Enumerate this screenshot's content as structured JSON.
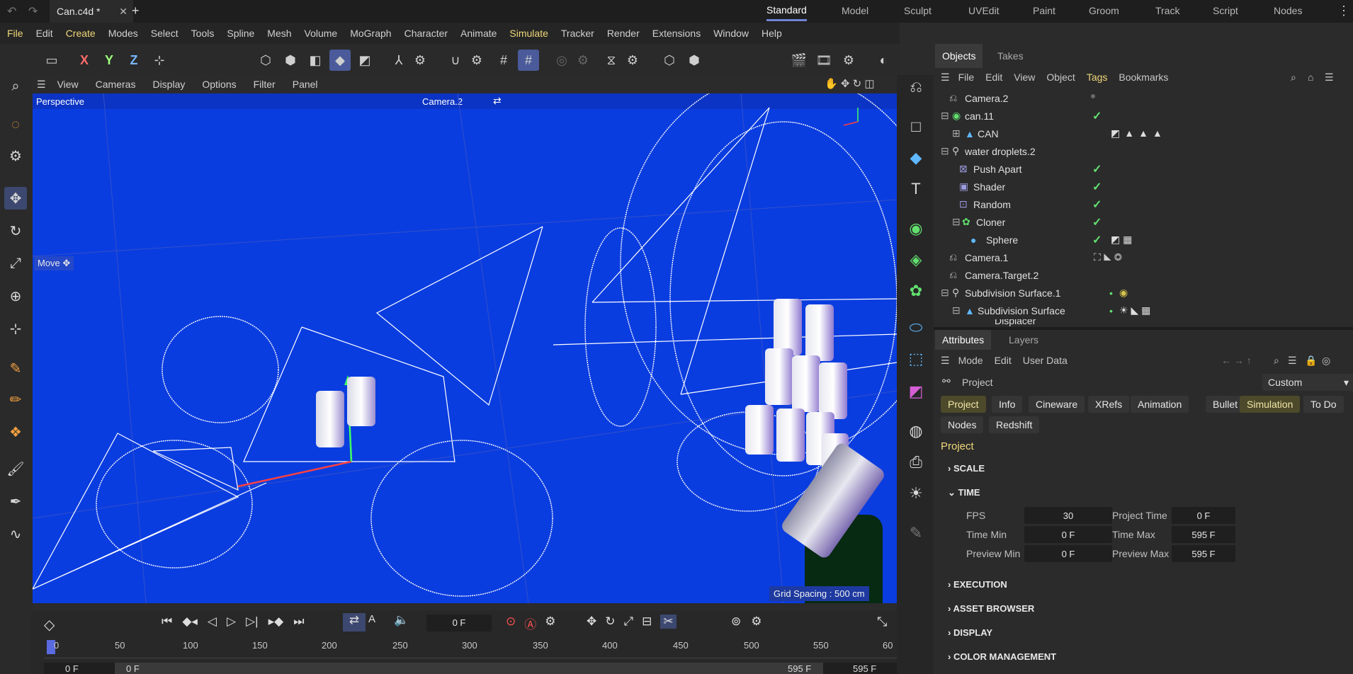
{
  "titlebar": {
    "document_tab": "Can.c4d *",
    "close": "✕",
    "add": "+",
    "layouts": [
      "Standard",
      "Model",
      "Sculpt",
      "UVEdit",
      "Paint",
      "Groom",
      "Track",
      "Script",
      "Nodes"
    ],
    "active_layout": "Standard"
  },
  "menubar": {
    "items": [
      "File",
      "Edit",
      "Create",
      "Modes",
      "Select",
      "Tools",
      "Spline",
      "Mesh",
      "Volume",
      "MoGraph",
      "Character",
      "Animate",
      "Simulate",
      "Tracker",
      "Render",
      "Extensions",
      "Window",
      "Help"
    ]
  },
  "toolbar": {
    "axes": [
      "X",
      "Y",
      "Z"
    ]
  },
  "viewport": {
    "menu": [
      "View",
      "Cameras",
      "Display",
      "Options",
      "Filter",
      "Panel"
    ],
    "projection": "Perspective",
    "camera": "Camera.2",
    "hud_move": "Move ✥",
    "grid_spacing": "Grid Spacing : 500 cm",
    "background_color": "#0a3de0"
  },
  "objects_panel": {
    "tabs": [
      "Objects",
      "Takes"
    ],
    "menu": [
      "File",
      "Edit",
      "View",
      "Object",
      "Tags",
      "Bookmarks"
    ],
    "rows": [
      {
        "name": "Camera.2",
        "indent": 0,
        "check": false
      },
      {
        "name": "can.11",
        "indent": 0,
        "check": true
      },
      {
        "name": "CAN",
        "indent": 1,
        "check": false
      },
      {
        "name": "water droplets.2",
        "indent": 0,
        "check": false
      },
      {
        "name": "Push Apart",
        "indent": 1,
        "check": true
      },
      {
        "name": "Shader",
        "indent": 1,
        "check": true
      },
      {
        "name": "Random",
        "indent": 1,
        "check": true
      },
      {
        "name": "Cloner",
        "indent": 1,
        "check": true
      },
      {
        "name": "Sphere",
        "indent": 2,
        "check": true
      },
      {
        "name": "Camera.1",
        "indent": 0,
        "check": false
      },
      {
        "name": "Camera.Target.2",
        "indent": 0,
        "check": false
      },
      {
        "name": "Subdivision Surface.1",
        "indent": 0,
        "check": false
      },
      {
        "name": "Subdivision Surface",
        "indent": 1,
        "check": false
      },
      {
        "name": "Displacer",
        "indent": 2,
        "check": true
      }
    ]
  },
  "attributes_panel": {
    "tabs": [
      "Attributes",
      "Layers"
    ],
    "menu": [
      "Mode",
      "Edit",
      "User Data"
    ],
    "object_label": "Project",
    "preset": "Custom",
    "buttons": [
      "Project",
      "Info",
      "Cineware",
      "XRefs",
      "Animation",
      "Bullet",
      "Simulation",
      "To Do",
      "Nodes",
      "Redshift"
    ],
    "heading": "Project",
    "sections": [
      "SCALE",
      "TIME",
      "EXECUTION",
      "ASSET BROWSER",
      "DISPLAY",
      "COLOR MANAGEMENT"
    ],
    "time": {
      "fps_label": "FPS",
      "fps": "30",
      "project_time_label": "Project Time",
      "project_time": "0 F",
      "time_min_label": "Time Min",
      "time_min": "0 F",
      "time_max_label": "Time Max",
      "time_max": "595 F",
      "preview_min_label": "Preview Min",
      "preview_min": "0 F",
      "preview_max_label": "Preview Max",
      "preview_max": "595 F"
    }
  },
  "timeline": {
    "current_frame": "0 F",
    "ticks": [
      "0",
      "50",
      "100",
      "150",
      "200",
      "250",
      "300",
      "350",
      "400",
      "450",
      "500",
      "550",
      "60"
    ],
    "range_start": "0 F",
    "range_start2": "0 F",
    "range_end": "595 F",
    "range_end2": "595 F"
  }
}
